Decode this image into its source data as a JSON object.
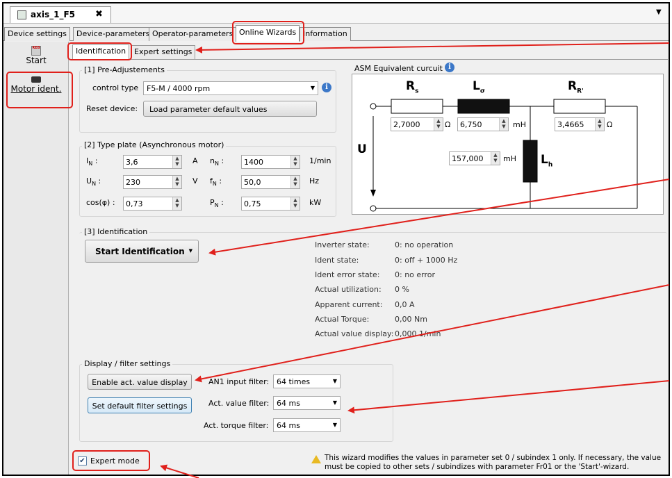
{
  "document_tab": {
    "title": "axis_1_F5",
    "close": "✖"
  },
  "main_tabs": [
    {
      "label": "Device settings"
    },
    {
      "label": "Device-parameters"
    },
    {
      "label": "Operator-parameters"
    },
    {
      "label": "Online Wizards"
    },
    {
      "label": "Information"
    }
  ],
  "sidebar": {
    "start": {
      "icon_text": "KEB",
      "label": "Start"
    },
    "motor_ident": {
      "label": "Motor ident."
    }
  },
  "sub_tabs": [
    {
      "label": "Identification"
    },
    {
      "label": "Expert settings"
    }
  ],
  "pre_adjust": {
    "legend": "[1] Pre-Adjustements",
    "control_type_label": "control type",
    "control_type_value": "F5-M / 4000 rpm",
    "reset_label": "Reset device:",
    "reset_button": "Load parameter default values"
  },
  "type_plate": {
    "legend": "[2] Type plate (Asynchronous motor)",
    "in_label": "I",
    "in_sub": "N",
    "in_value": "3,6",
    "in_unit": "A",
    "un_label": "U",
    "un_sub": "N",
    "un_value": "230",
    "un_unit": "V",
    "cos_label": "cos(φ) :",
    "cos_value": "0,73",
    "nn_label": "n",
    "nn_sub": "N",
    "nn_value": "1400",
    "nn_unit": "1/min",
    "fn_label": "f",
    "fn_sub": "N",
    "fn_value": "50,0",
    "fn_unit": "Hz",
    "pn_label": "P",
    "pn_sub": "N",
    "pn_value": "0,75",
    "pn_unit": "kW",
    "colon": ":"
  },
  "circuit": {
    "title": "ASM Equivalent curcuit",
    "rs_label": "R",
    "rs_sub": "s",
    "rs_value": "2,7000",
    "rs_unit": "Ω",
    "lsigma_label": "L",
    "lsigma_sub": "σ",
    "lsigma_value": "6,750",
    "lsigma_unit": "mH",
    "rr_label": "R",
    "rr_sub": "R'",
    "rr_value": "3,4665",
    "rr_unit": "Ω",
    "lh_label": "L",
    "lh_sub": "h",
    "lh_value": "157,000",
    "lh_unit": "mH",
    "u_label": "U"
  },
  "identification": {
    "legend": "[3] Identification",
    "start_button": "Start Identification",
    "status": [
      {
        "label": "Inverter state:",
        "value": "0: no operation"
      },
      {
        "label": "Ident state:",
        "value": "0: off + 1000 Hz"
      },
      {
        "label": "Ident error state:",
        "value": "0: no error"
      },
      {
        "label": "Actual utilization:",
        "value": "0 %"
      },
      {
        "label": "Apparent current:",
        "value": "0,0 A"
      },
      {
        "label": "Actual Torque:",
        "value": "0,00 Nm"
      },
      {
        "label": "Actual value display:",
        "value": "0,000 1/min"
      }
    ]
  },
  "display_filter": {
    "legend": "Display / filter settings",
    "enable_button": "Enable act. value display",
    "default_button": "Set default filter settings",
    "an1_label": "AN1 input filter:",
    "an1_value": "64 times",
    "act_value_label": "Act. value filter:",
    "act_value_value": "64 ms",
    "act_torque_label": "Act. torque filter:",
    "act_torque_value": "64 ms"
  },
  "footer": {
    "expert_mode_label": "Expert mode",
    "expert_mode_checked": true,
    "warning_line1": "This wizard modifies the values in parameter set 0 / subindex 1 only. If necessary, the value",
    "warning_line2": "must be copied to other sets / subindizes with parameter Fr01 or the 'Start'-wizard."
  },
  "colors": {
    "annotation_red": "#e0201b",
    "info_blue": "#3c78c8",
    "inductor_black": "#111111"
  },
  "icons": [
    "document-icon",
    "close-icon",
    "chevron-down-icon",
    "keb-icon",
    "motor-icon",
    "info-icon",
    "spin-icon",
    "warning-icon",
    "checkbox-icon"
  ]
}
